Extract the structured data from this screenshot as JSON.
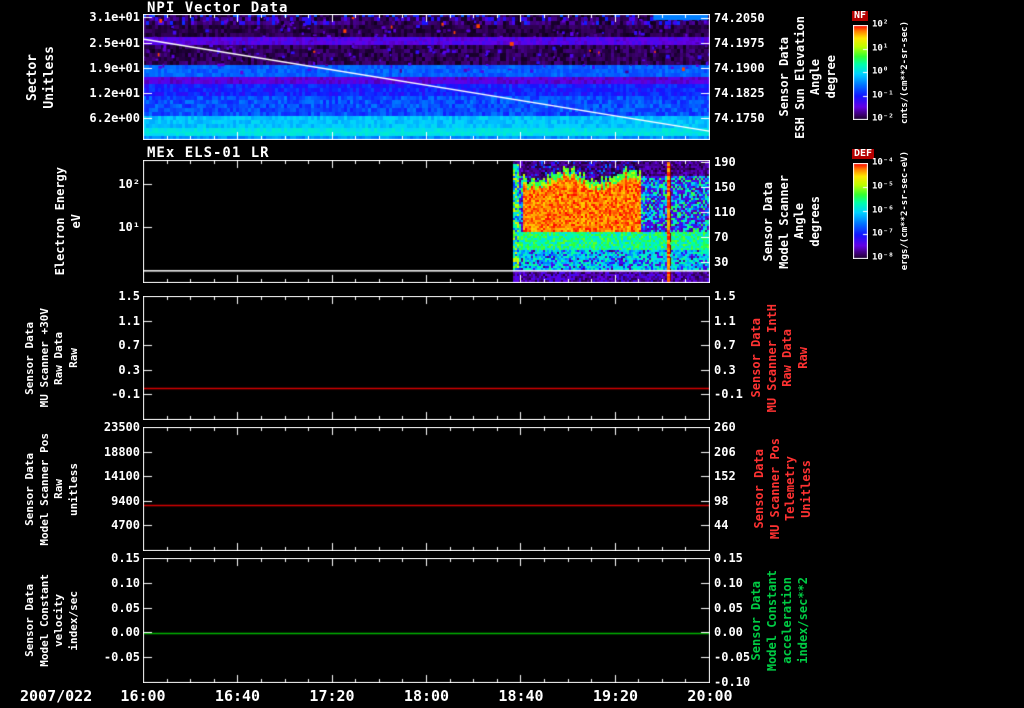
{
  "colors": {
    "background": "#000000",
    "foreground": "#ffffff",
    "red_series": "#d80000",
    "green_series": "#00b400",
    "red_label": "#ff3232",
    "green_label": "#00cc44"
  },
  "chart_data": {
    "type": "heatmap",
    "subtype": "multi-panel time-series with spectrograms",
    "time_axis": {
      "date": "2007/022",
      "ticks": [
        "16:00",
        "16:40",
        "17:20",
        "18:00",
        "18:40",
        "19:20",
        "20:00"
      ],
      "minor_divisions_per_major": 4
    },
    "panels": [
      {
        "type": "heatmap",
        "title": "NPI Vector Data",
        "ylabel": [
          "Sector",
          "Unitless"
        ],
        "ylabel_color": "#ffffff",
        "yticks": [
          {
            "label": "3.1e+01",
            "pos": 0.025
          },
          {
            "label": "2.5e+01",
            "pos": 0.23
          },
          {
            "label": "1.9e+01",
            "pos": 0.43
          },
          {
            "label": "1.2e+01",
            "pos": 0.635
          },
          {
            "label": "6.2e+00",
            "pos": 0.835
          }
        ],
        "right_ticks": [
          {
            "label": "74.2050",
            "pos": 0.03
          },
          {
            "label": "74.1975",
            "pos": 0.23
          },
          {
            "label": "74.1900",
            "pos": 0.43
          },
          {
            "label": "74.1825",
            "pos": 0.63
          },
          {
            "label": "74.1750",
            "pos": 0.83
          }
        ],
        "right_label": [
          "Sensor Data",
          "ESH Sun Elevation",
          "Angle",
          "degree"
        ],
        "right_label_color": "#ffffff",
        "overlay_line": {
          "color": "#ffffff",
          "y0_frac": 0.2,
          "y1_frac": 0.93,
          "meaning": "ESH sun elevation angle decreasing from ~74.201 to ~74.172 degrees over 16:00-20:00"
        },
        "heatmap": {
          "kind": "npi",
          "rows": 32,
          "value_units": "cnts/(cm**2-sr-sec)",
          "bands": [
            {
              "y0": 0.0,
              "y1": 0.045,
              "v": 0.05,
              "n": 0.04,
              "sparse": 0.3,
              "bright": 0.32
            },
            {
              "y0": 0.045,
              "y1": 0.1,
              "v": 0.07,
              "n": 0.05,
              "sparse": 0.18,
              "bright": 0.24
            },
            {
              "y0": 0.1,
              "y1": 0.2,
              "v": 0.05,
              "n": 0.03
            },
            {
              "y0": 0.2,
              "y1": 0.265,
              "v": 0.17,
              "n": 0.04
            },
            {
              "y0": 0.265,
              "y1": 0.42,
              "v": 0.06,
              "n": 0.04
            },
            {
              "y0": 0.42,
              "y1": 0.505,
              "v": 0.36,
              "n": 0.04
            },
            {
              "y0": 0.505,
              "y1": 0.575,
              "v": 0.16,
              "n": 0.04
            },
            {
              "y0": 0.575,
              "y1": 0.65,
              "v": 0.28,
              "n": 0.05
            },
            {
              "y0": 0.65,
              "y1": 0.8,
              "v": 0.34,
              "n": 0.06
            },
            {
              "y0": 0.8,
              "y1": 0.9,
              "v": 0.48,
              "n": 0.04
            },
            {
              "y0": 0.9,
              "y1": 0.955,
              "v": 0.53,
              "n": 0.03
            },
            {
              "y0": 0.955,
              "y1": 1.01,
              "v": 0.42,
              "n": 0.04
            }
          ],
          "speckle": {
            "y0": 0.02,
            "y1": 0.45,
            "density": 0.05,
            "v": 0.1
          },
          "patches": [
            {
              "x0": 0.9,
              "x1": 1.0,
              "y0": 0.0,
              "y1": 0.04,
              "v": 0.4
            }
          ],
          "bright_line_y": 0.935
        }
      },
      {
        "type": "heatmap",
        "title": "MEx ELS-01 LR",
        "ylabel": [
          "Electron Energy",
          "eV"
        ],
        "ylabel_color": "#ffffff",
        "yticks": [
          {
            "label": "10²",
            "pos": 0.2
          },
          {
            "label": "10¹",
            "pos": 0.55
          }
        ],
        "right_ticks": [
          {
            "label": "190",
            "pos": 0.02
          },
          {
            "label": "150",
            "pos": 0.225
          },
          {
            "label": "110",
            "pos": 0.43
          },
          {
            "label": "70",
            "pos": 0.635
          },
          {
            "label": "30",
            "pos": 0.84
          }
        ],
        "right_label": [
          "Sensor Data",
          "Model Scanner",
          "Angle",
          "degrees"
        ],
        "right_label_color": "#ffffff",
        "white_line_y": 0.895,
        "heatmap": {
          "kind": "els",
          "value_units": "ergs/(cm**2-sr-sec-eV)",
          "data_start_frac": 0.655,
          "data_start_time": "~18:37",
          "blob_x0": 0.667,
          "blob_x1": 0.878,
          "blob_top_frac": 0.17,
          "blob_bottom_frac": 0.58,
          "vline_x": 0.924,
          "meaning": "no counts before ~18:37; intense red electron flux blob 18:40-19:30 at mid energies, vertical burst line near 19:42"
        }
      },
      {
        "type": "line",
        "title": "",
        "ylabel": [
          "Sensor Data",
          "MU Scanner +30V",
          "Raw Data",
          "Raw"
        ],
        "ylabel_color": "#ffffff",
        "yticks": [
          {
            "label": "1.5",
            "pos": 0.0
          },
          {
            "label": "1.1",
            "pos": 0.2
          },
          {
            "label": "0.7",
            "pos": 0.4
          },
          {
            "label": "0.3",
            "pos": 0.6
          },
          {
            "label": "-0.1",
            "pos": 0.8
          }
        ],
        "right_ticks": [
          {
            "label": "1.5",
            "pos": 0.0
          },
          {
            "label": "1.1",
            "pos": 0.2
          },
          {
            "label": "0.7",
            "pos": 0.4
          },
          {
            "label": "0.3",
            "pos": 0.6
          },
          {
            "label": "-0.1",
            "pos": 0.8
          }
        ],
        "right_label": [
          "Sensor Data",
          "MU Scanner IntH",
          "Raw Data",
          "Raw"
        ],
        "right_label_color": "#ff3232",
        "line": {
          "color": "#d80000",
          "value": 0.0,
          "y_frac": 0.74,
          "ylim_top": 1.5,
          "ylim_bottom": -0.5,
          "shape": "constant flat line"
        }
      },
      {
        "type": "line",
        "title": "",
        "ylabel": [
          "Sensor Data",
          "Model Scanner Pos",
          "Raw",
          "unitless"
        ],
        "ylabel_color": "#ffffff",
        "yticks": [
          {
            "label": "23500",
            "pos": 0.0
          },
          {
            "label": "18800",
            "pos": 0.2
          },
          {
            "label": "14100",
            "pos": 0.4
          },
          {
            "label": "9400",
            "pos": 0.6
          },
          {
            "label": "4700",
            "pos": 0.8
          }
        ],
        "right_ticks": [
          {
            "label": "260",
            "pos": 0.0
          },
          {
            "label": "206",
            "pos": 0.2
          },
          {
            "label": "152",
            "pos": 0.4
          },
          {
            "label": "98",
            "pos": 0.6
          },
          {
            "label": "44",
            "pos": 0.8
          }
        ],
        "right_label": [
          "Sensor Data",
          "MU Scanner Pos",
          "Telemetry",
          "Unitless"
        ],
        "right_label_color": "#ff3232",
        "line": {
          "color": "#d80000",
          "value": 8700,
          "y_frac": 0.63,
          "ylim_top": 23500,
          "ylim_bottom": 0,
          "shape": "constant flat line"
        }
      },
      {
        "type": "line",
        "title": "",
        "ylabel": [
          "Sensor Data",
          "Model Constant",
          "velocity",
          "index/sec"
        ],
        "ylabel_color": "#ffffff",
        "yticks": [
          {
            "label": "0.15",
            "pos": 0.0
          },
          {
            "label": "0.10",
            "pos": 0.2
          },
          {
            "label": "0.05",
            "pos": 0.4
          },
          {
            "label": "0.00",
            "pos": 0.6
          },
          {
            "label": "-0.05",
            "pos": 0.8
          }
        ],
        "right_ticks": [
          {
            "label": "0.15",
            "pos": 0.0
          },
          {
            "label": "0.10",
            "pos": 0.2
          },
          {
            "label": "0.05",
            "pos": 0.4
          },
          {
            "label": "0.00",
            "pos": 0.6
          },
          {
            "label": "-0.05",
            "pos": 0.8
          },
          {
            "label": "-0.10",
            "pos": 1.0
          }
        ],
        "right_label": [
          "Sensor Data",
          "Model Constant",
          "acceleration",
          "index/sec**2"
        ],
        "right_label_color": "#00cc44",
        "line": {
          "color": "#00b400",
          "value": 0.0,
          "y_frac": 0.6,
          "ylim_top": 0.15,
          "ylim_bottom": -0.1,
          "shape": "constant flat line"
        }
      }
    ],
    "colorbars": [
      {
        "title": "NF",
        "units": "cnts/(cm**2-sr-sec)",
        "ticks": [
          "10²",
          "10¹",
          "10⁰",
          "10⁻¹",
          "10⁻²"
        ]
      },
      {
        "title": "DEF",
        "units": "ergs/(cm**2-sr-sec-eV)",
        "ticks": [
          "10⁻⁴",
          "10⁻⁵",
          "10⁻⁶",
          "10⁻⁷",
          "10⁻⁸"
        ]
      }
    ]
  }
}
